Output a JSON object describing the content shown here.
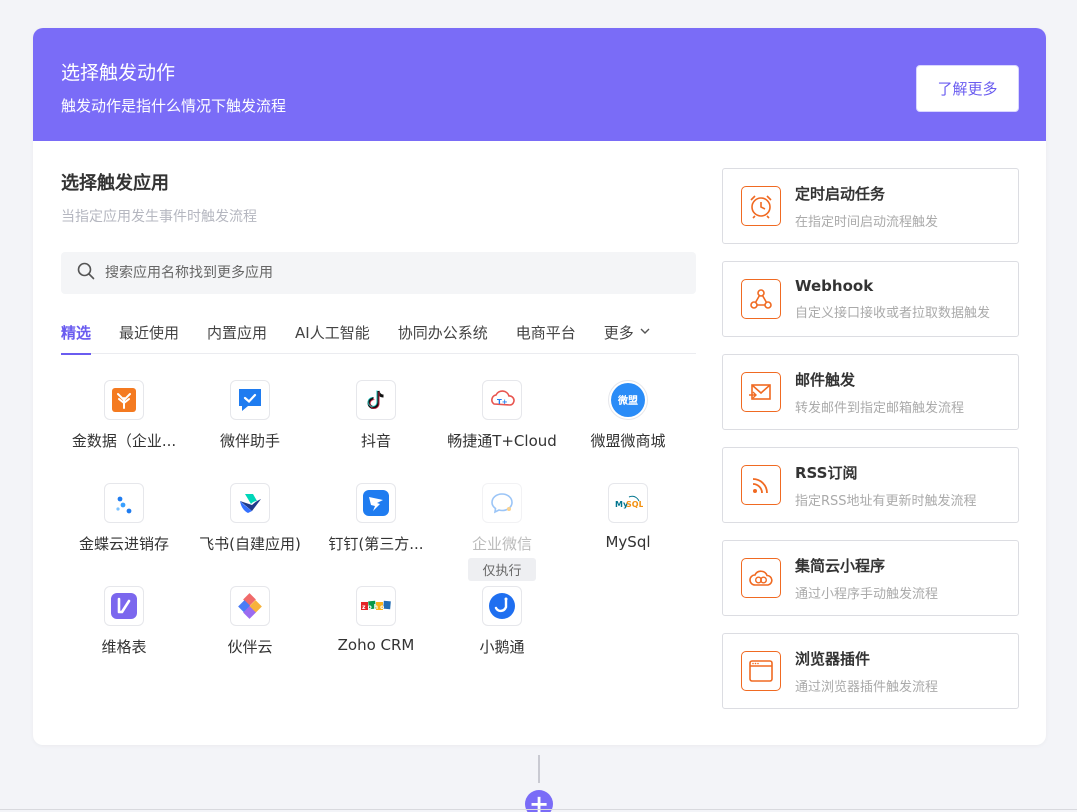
{
  "banner": {
    "title": "选择触发动作",
    "subtitle": "触发动作是指什么情况下触发流程",
    "learn_more": "了解更多",
    "bg_color": "#7a6cf7"
  },
  "apps_section": {
    "title": "选择触发应用",
    "subtitle": "当指定应用发生事件时触发流程",
    "search_placeholder": "搜索应用名称找到更多应用",
    "tabs": [
      "精选",
      "最近使用",
      "内置应用",
      "AI人工智能",
      "协同办公系统",
      "电商平台",
      "更多"
    ],
    "active_tab": "精选",
    "apps": [
      {
        "name": "金数据（企业...",
        "icon": "jinshuju-icon"
      },
      {
        "name": "微伴助手",
        "icon": "weiban-icon"
      },
      {
        "name": "抖音",
        "icon": "douyin-icon"
      },
      {
        "name": "畅捷通T+Cloud",
        "icon": "chanjet-icon"
      },
      {
        "name": "微盟微商城",
        "icon": "weimob-icon"
      },
      {
        "name": "金蝶云进销存",
        "icon": "kingdee-icon"
      },
      {
        "name": "飞书(自建应用)",
        "icon": "feishu-icon"
      },
      {
        "name": "钉钉(第三方...",
        "icon": "dingtalk-icon"
      },
      {
        "name": "企业微信",
        "icon": "wecom-icon",
        "disabled": true,
        "badge": "仅执行"
      },
      {
        "name": "MySql",
        "icon": "mysql-icon"
      },
      {
        "name": "维格表",
        "icon": "vika-icon"
      },
      {
        "name": "伙伴云",
        "icon": "huoban-icon"
      },
      {
        "name": "Zoho CRM",
        "icon": "zoho-icon"
      },
      {
        "name": "小鹅通",
        "icon": "xiaoetong-icon"
      }
    ]
  },
  "triggers": [
    {
      "name": "定时启动任务",
      "desc": "在指定时间启动流程触发",
      "icon": "alarm-clock-icon"
    },
    {
      "name": "Webhook",
      "desc": "自定义接口接收或者拉取数据触发",
      "icon": "webhook-icon"
    },
    {
      "name": "邮件触发",
      "desc": "转发邮件到指定邮箱触发流程",
      "icon": "mail-icon"
    },
    {
      "name": "RSS订阅",
      "desc": "指定RSS地址有更新时触发流程",
      "icon": "rss-icon"
    },
    {
      "name": "集简云小程序",
      "desc": "通过小程序手动触发流程",
      "icon": "cloud-icon"
    },
    {
      "name": "浏览器插件",
      "desc": "通过浏览器插件触发流程",
      "icon": "browser-icon"
    }
  ],
  "accent_color": "#6a5cf0",
  "trigger_icon_color": "#f06a22",
  "add_button": "+"
}
